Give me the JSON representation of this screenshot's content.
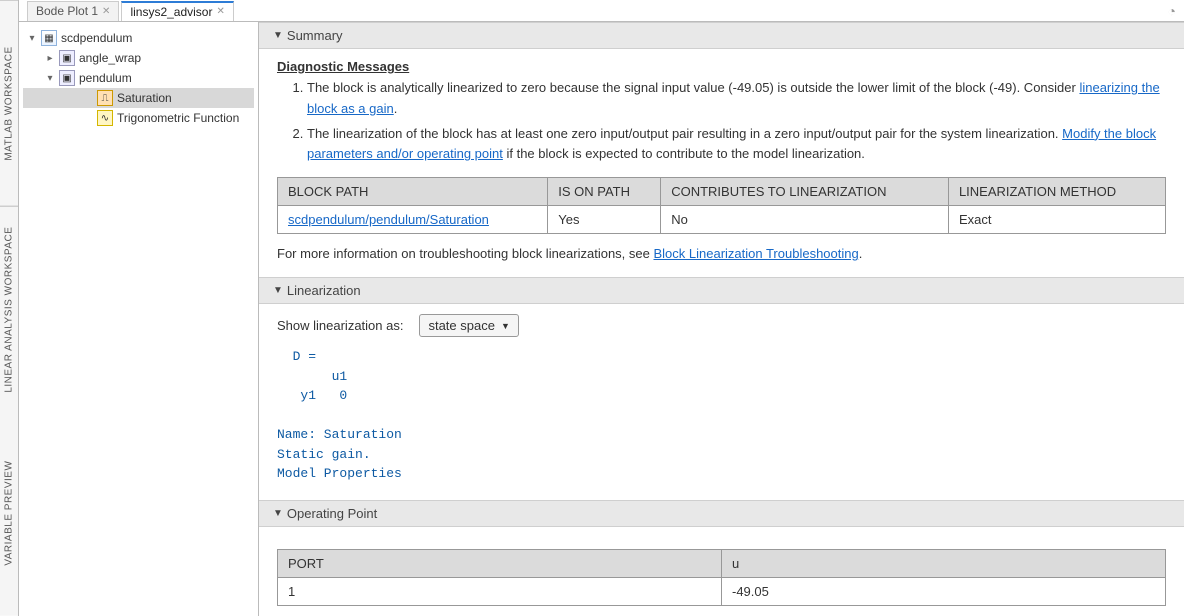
{
  "vtabs": {
    "matlab_workspace": "MATLAB WORKSPACE",
    "linear_workspace": "LINEAR ANALYSIS WORKSPACE",
    "variable_preview": "VARIABLE PREVIEW"
  },
  "tabs": {
    "bode": "Bode Plot 1",
    "advisor": "linsys2_advisor"
  },
  "tree": {
    "root": "scdpendulum",
    "angle_wrap": "angle_wrap",
    "pendulum": "pendulum",
    "saturation": "Saturation",
    "trig": "Trigonometric Function"
  },
  "sections": {
    "summary": "Summary",
    "linearization": "Linearization",
    "operating_point": "Operating Point"
  },
  "diag": {
    "heading": "Diagnostic Messages",
    "msg1_a": "The block is analytically linearized to zero because the signal input value (-49.05) is outside the lower limit of the block (-49). Consider ",
    "msg1_link": "linearizing the block as a gain",
    "msg1_b": ".",
    "msg2_a": "The linearization of the block has at least one zero input/output pair resulting in a zero input/output pair for the system linearization. ",
    "msg2_link": "Modify the block parameters and/or operating point",
    "msg2_b": " if the block is expected to contribute to the model linearization."
  },
  "table1": {
    "h_path": "BLOCK PATH",
    "h_onpath": "IS ON PATH",
    "h_contrib": "CONTRIBUTES TO LINEARIZATION",
    "h_method": "LINEARIZATION METHOD",
    "r_path": "scdpendulum/pendulum/Saturation",
    "r_onpath": "Yes",
    "r_contrib": "No",
    "r_method": "Exact"
  },
  "moreinfo_a": "For more information on troubleshooting block linearizations, see ",
  "moreinfo_link": "Block Linearization Troubleshooting",
  "moreinfo_b": ".",
  "lin": {
    "show_label": "Show linearization as:",
    "dropdown": "state space",
    "code": "  D = \n       u1\n   y1   0\n \nName: Saturation\nStatic gain.\nModel Properties"
  },
  "op": {
    "h_port": "PORT",
    "h_u": "u",
    "r_port": "1",
    "r_u": "-49.05"
  }
}
